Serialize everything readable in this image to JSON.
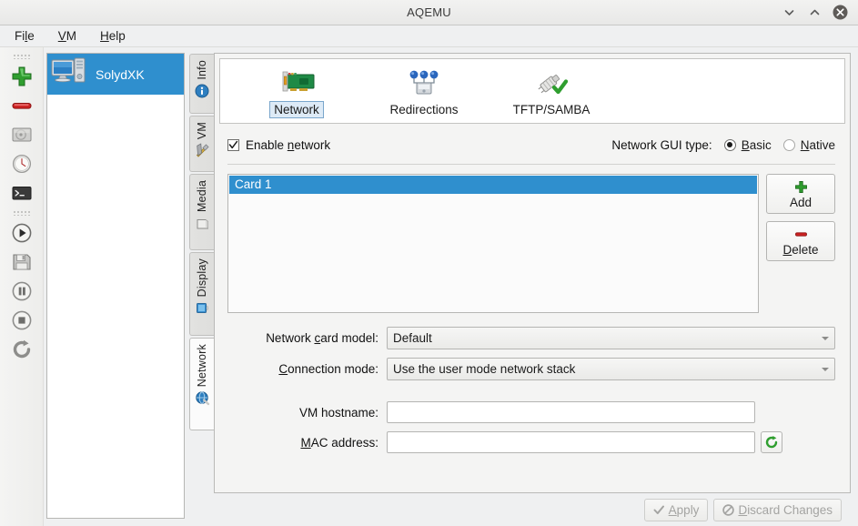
{
  "window": {
    "title": "AQEMU",
    "controls": [
      {
        "name": "minimize",
        "glyph": "chevron-down"
      },
      {
        "name": "maximize",
        "glyph": "chevron-up"
      },
      {
        "name": "close",
        "glyph": "close-circle"
      }
    ]
  },
  "menubar": {
    "items": [
      {
        "label": "File",
        "mnemonic_index": 2
      },
      {
        "label": "VM",
        "mnemonic_index": 0
      },
      {
        "label": "Help",
        "mnemonic_index": 0
      }
    ]
  },
  "left_toolbar": {
    "buttons": [
      {
        "name": "new-vm",
        "icon": "green-plus-icon",
        "label": ""
      },
      {
        "name": "delete-vm",
        "icon": "red-minus-icon",
        "label": ""
      },
      {
        "name": "hard-disk",
        "icon": "hard-disk-icon",
        "label": ""
      },
      {
        "name": "snapshot",
        "icon": "clock-icon",
        "label": ""
      },
      {
        "name": "console",
        "icon": "terminal-icon",
        "label": ""
      },
      {
        "name": "start-vm",
        "icon": "play-icon",
        "label": ""
      },
      {
        "name": "save-vm",
        "icon": "floppy-save-icon",
        "label": ""
      },
      {
        "name": "pause-vm",
        "icon": "pause-icon",
        "label": ""
      },
      {
        "name": "stop-vm",
        "icon": "stop-icon",
        "label": ""
      },
      {
        "name": "restart-vm",
        "icon": "restart-icon",
        "label": ""
      }
    ]
  },
  "vm_list": {
    "items": [
      {
        "name": "SolydXK",
        "selected": true
      }
    ]
  },
  "vertical_tabs": {
    "items": [
      {
        "label": "Info",
        "icon": "info-icon",
        "active": false
      },
      {
        "label": "VM",
        "icon": "tools-icon",
        "active": false
      },
      {
        "label": "Media",
        "icon": "media-icon",
        "active": false
      },
      {
        "label": "Display",
        "icon": "display-icon",
        "active": false
      },
      {
        "label": "Network",
        "icon": "network-globe-icon",
        "active": true
      }
    ]
  },
  "icon_tabs": {
    "items": [
      {
        "label": "Network",
        "icon": "network-card-icon",
        "selected": true
      },
      {
        "label": "Redirections",
        "icon": "redirections-icon",
        "selected": false
      },
      {
        "label": "TFTP/SAMBA",
        "icon": "tftp-samba-icon",
        "selected": false
      }
    ]
  },
  "network_panel": {
    "enable_network": {
      "label": "Enable network",
      "checked": true,
      "mnemonic_index": 7
    },
    "gui_type": {
      "label": "Network GUI type:",
      "options": [
        {
          "label": "Basic",
          "selected": true,
          "mnemonic_index": 0
        },
        {
          "label": "Native",
          "selected": false,
          "mnemonic_index": 0
        }
      ]
    },
    "cards": {
      "items": [
        {
          "label": "Card 1",
          "selected": true
        }
      ],
      "add_button": {
        "label": "Add",
        "icon": "green-plus-icon"
      },
      "delete_button": {
        "label": "Delete",
        "icon": "red-minus-icon",
        "mnemonic_index": 0
      }
    },
    "fields": {
      "card_model": {
        "label": "Network card model:",
        "value": "Default",
        "mnemonic_index": 12
      },
      "connection_mode": {
        "label": "Connection mode:",
        "value": "Use the user mode network stack",
        "mnemonic_index": 0
      },
      "hostname": {
        "label": "VM hostname:",
        "value": "",
        "placeholder": ""
      },
      "mac_address": {
        "label": "MAC address:",
        "value": "",
        "placeholder": "",
        "regenerate_icon": "refresh-icon",
        "mnemonic_index": 0
      }
    }
  },
  "bottom_bar": {
    "apply": {
      "label": "Apply",
      "icon": "check-icon",
      "enabled": false
    },
    "discard": {
      "label": "Discard Changes",
      "icon": "no-entry-icon",
      "enabled": false
    }
  },
  "colors": {
    "selection_blue": "#2f8fce",
    "tab_selection_fill": "#ddeaf6",
    "tab_selection_border": "#7aa6cc",
    "window_bg": "#eff0f1",
    "accent_green": "#2f9e2f",
    "accent_red": "#c82020"
  }
}
